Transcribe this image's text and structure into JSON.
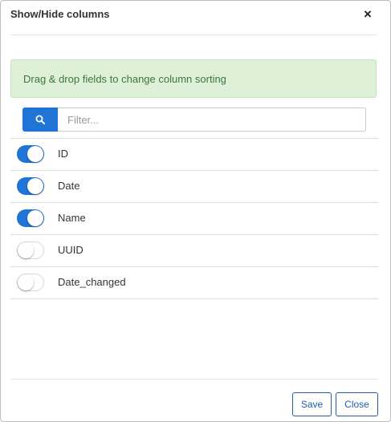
{
  "dialog": {
    "title": "Show/Hide columns",
    "close_glyph": "×",
    "close_icon": "close-icon"
  },
  "alert": {
    "text": "Drag & drop fields to change column sorting",
    "background": "#dff0d8",
    "text_color": "#3c763d"
  },
  "search": {
    "icon": "search-icon",
    "placeholder": "Filter...",
    "value": "",
    "button_color": "#1f74d6"
  },
  "columns": [
    {
      "label": "ID",
      "enabled": true
    },
    {
      "label": "Date",
      "enabled": true
    },
    {
      "label": "Name",
      "enabled": true
    },
    {
      "label": "UUID",
      "enabled": false
    },
    {
      "label": "Date_changed",
      "enabled": false
    }
  ],
  "footer": {
    "save_label": "Save",
    "close_label": "Close"
  },
  "colors": {
    "accent": "#1f74d6",
    "button_border": "#1f5ea8"
  }
}
